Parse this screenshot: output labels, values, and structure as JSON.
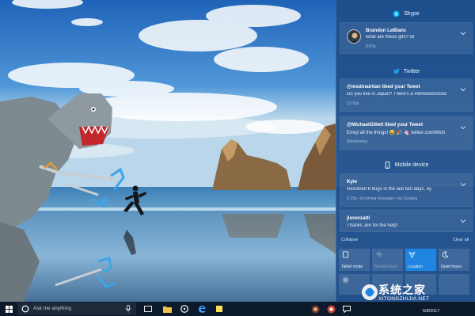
{
  "action_center": {
    "groups": {
      "skype": "Skype",
      "twitter": "Twitter",
      "mobile": "Mobile device"
    },
    "notifications": [
      {
        "title": "Brandon LeBlanc",
        "body": "what are these gifs? lol",
        "meta": "8:07p"
      },
      {
        "title": "@msdmairitan liked your Tweet",
        "body": "Do you live in Japan? There's a #WindowsInsid",
        "meta": "12:16p"
      },
      {
        "title": "@MichaelGillett liked your Tweet",
        "body": "Emoji all the things! 😄 🎉 🦄 twitter.com/Mich",
        "meta": "Wednesday"
      },
      {
        "title": "Kyle",
        "body": "Resolved 6 bugs in the last two days, oy",
        "meta": "6:15p • Incoming message • via Cortana"
      },
      {
        "title": "jlorenzatti",
        "body": "Thanks Jen for the help!",
        "meta": ""
      }
    ],
    "collapse_label": "Collapse",
    "clear_label": "Clear all",
    "quick_actions": [
      {
        "label": "Tablet mode",
        "icon": "tablet-icon",
        "active": false,
        "dim": false
      },
      {
        "label": "Rotation lock",
        "icon": "rotation-lock-icon",
        "active": false,
        "dim": true
      },
      {
        "label": "Location",
        "icon": "location-icon",
        "active": true,
        "dim": false
      },
      {
        "label": "Quiet hours",
        "icon": "moon-icon",
        "active": false,
        "dim": false
      },
      {
        "label": "",
        "icon": "brightness-icon",
        "active": false,
        "dim": false
      }
    ]
  },
  "taskbar": {
    "search_placeholder": "Ask me anything",
    "time": "",
    "date": "6/8/2017"
  },
  "watermark": {
    "text": "系统之家",
    "url": "XITONGZHIJIA.NET"
  },
  "colors": {
    "action_center_bg": "#1e4e8a",
    "accent": "#1e86e0",
    "taskbar_bg": "#0d1a2b",
    "skype": "#00aff0",
    "twitter": "#1da1f2"
  }
}
